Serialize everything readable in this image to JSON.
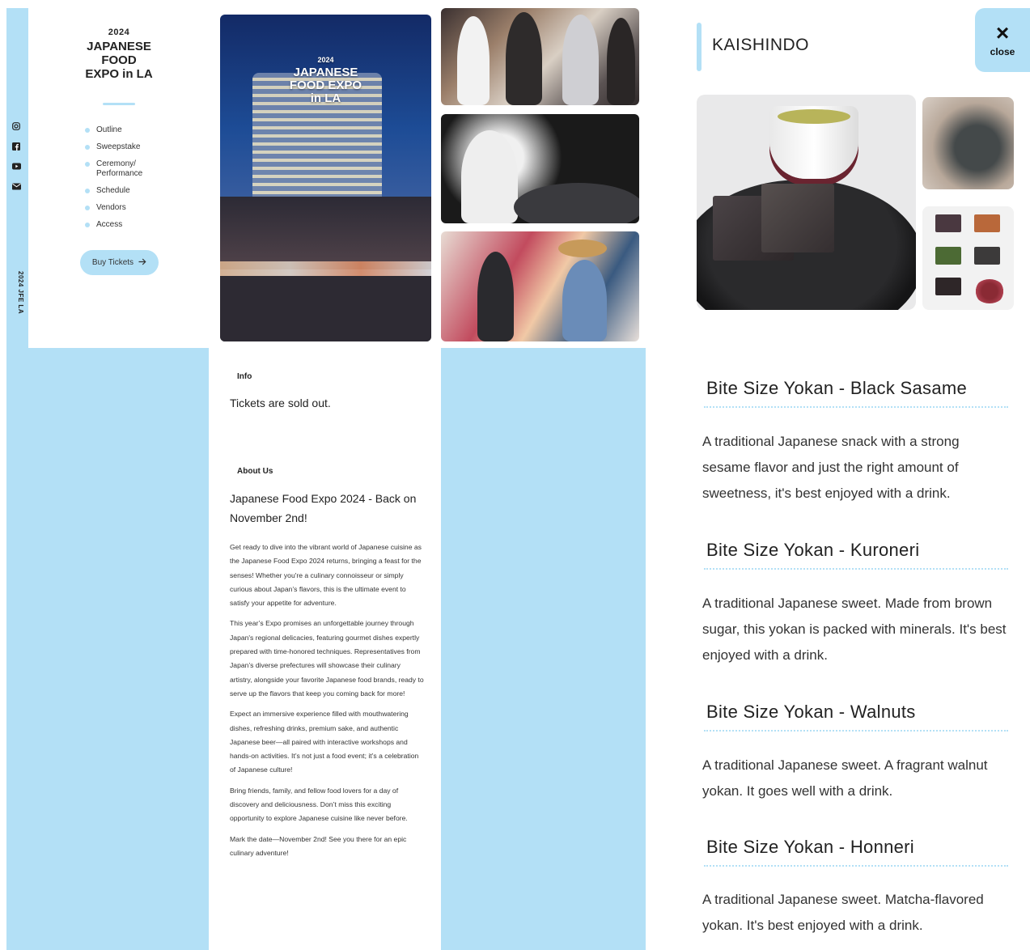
{
  "brand": {
    "year": "2024",
    "name": "JAPANESE\nFOOD\nEXPO in LA"
  },
  "nav": {
    "items": [
      "Outline",
      "Sweepstake",
      "Ceremony/\nPerformance",
      "Schedule",
      "Vendors",
      "Access"
    ],
    "buy_label": "Buy Tickets",
    "vertical_text": "2024 JFE LA"
  },
  "social": [
    "instagram-icon",
    "facebook-icon",
    "youtube-icon",
    "mail-icon"
  ],
  "hero": {
    "year": "2024",
    "title": "JAPANESE\nFOOD EXPO\nin LA"
  },
  "info": {
    "label": "Info",
    "text": "Tickets are sold out."
  },
  "about": {
    "label": "About Us",
    "title": "Japanese Food Expo 2024 - Back on November 2nd!",
    "paragraphs": [
      "Get ready to dive into the vibrant world of Japanese cuisine as the Japanese Food Expo 2024 returns, bringing a feast for the senses! Whether you're a culinary connoisseur or simply curious about Japan’s flavors, this is the ultimate event to satisfy your appetite for adventure.",
      "This year’s Expo promises an unforgettable journey through Japan's regional delicacies, featuring gourmet dishes expertly prepared with time-honored techniques. Representatives from Japan’s diverse prefectures will showcase their culinary artistry, alongside your favorite Japanese food brands, ready to serve up the flavors that keep you coming back for more!",
      "Expect an immersive experience filled with mouthwatering dishes, refreshing drinks, premium sake, and authentic Japanese beer—all paired with interactive workshops and hands-on activities. It’s not just a food event; it’s a celebration of Japanese culture!",
      "Bring friends, family, and fellow food lovers for a day of discovery and deliciousness. Don’t miss this exciting opportunity to explore Japanese cuisine like never before.",
      "Mark the date—November 2nd! See you there for an epic culinary adventure!"
    ]
  },
  "vendor": {
    "name": "KAISHINDO",
    "close_label": "close",
    "products": [
      {
        "title": "Bite Size Yokan - Black Sasame",
        "desc": "A traditional Japanese snack with a strong sesame flavor and just the right amount of sweetness, it's best enjoyed with a drink."
      },
      {
        "title": "Bite Size Yokan - Kuroneri",
        "desc": "A traditional Japanese sweet. Made from brown sugar, this yokan is packed with minerals. It's best enjoyed with a drink."
      },
      {
        "title": "Bite Size Yokan - Walnuts",
        "desc": "A traditional Japanese sweet. A fragrant walnut yokan. It goes well with a drink."
      },
      {
        "title": "Bite Size Yokan - Honneri",
        "desc": "A traditional Japanese sweet. Matcha-flavored yokan. It's best enjoyed with a drink."
      }
    ]
  },
  "colors": {
    "accent": "#b3e0f6",
    "text": "#222222"
  }
}
